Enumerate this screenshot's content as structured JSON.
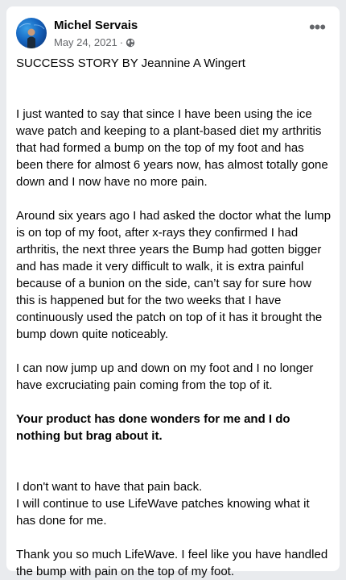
{
  "post": {
    "author": "Michel Servais",
    "date": "May 24, 2021",
    "separator": "·",
    "audience_icon": "globe-icon",
    "more_icon": "more-options-icon",
    "more_label": "•••"
  },
  "content": {
    "title": "SUCCESS STORY BY Jeannine A Wingert",
    "p1": "I just wanted to say that since I have been using the ice wave patch and keeping to a plant-based diet my arthritis that had formed a bump on the top of my foot and has been there for almost 6 years now, has almost totally gone down and I now have no more pain.",
    "p2": "Around six years ago I had asked the doctor what the lump is on top of my foot, after x-rays they confirmed I had arthritis, the next three years the Bump had gotten bigger and has made it very difficult to walk, it is extra painful because of a bunion on the side, can’t say for sure how this is happened but for the two weeks that I have continuously used the patch on top of it has it brought the bump down quite noticeably.",
    "p3": "I can now jump up and down on my foot and I no longer have excruciating pain coming from the top of it.",
    "p4": "Your product has done wonders for me and I do nothing but brag about it.",
    "p5a": "I don't want to have that pain back.",
    "p5b": "I will continue to use LifeWave patches knowing what it has done for me.",
    "p6": "Thank you so much LifeWave. I feel like you have handled the bump with pain on the top of my foot."
  }
}
